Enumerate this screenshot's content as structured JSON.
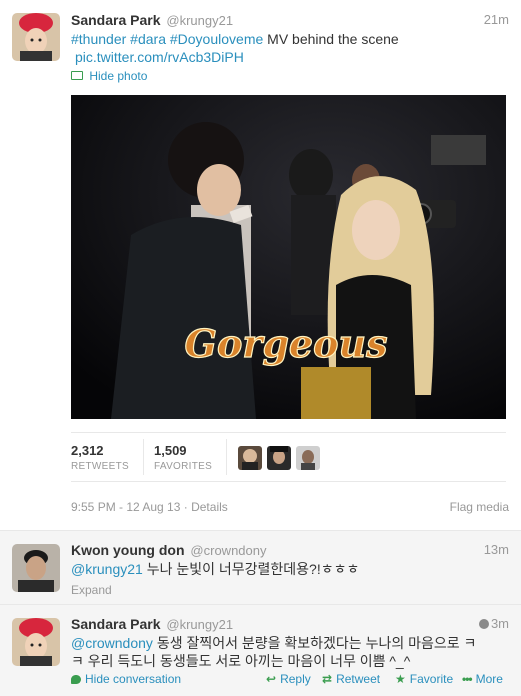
{
  "tweet1": {
    "name": "Sandara Park",
    "handle": "@krungy21",
    "time": "21m",
    "hashtags": [
      "#thunder",
      "#dara",
      "#Doyouloveme"
    ],
    "text_rest": "MV behind the scene",
    "pic_link": "pic.twitter.com/rvAcb3DiPH",
    "hide_photo": "Hide photo",
    "photo_caption": "Gorgeous",
    "retweets": "2,312",
    "retweets_label": "RETWEETS",
    "favorites": "1,509",
    "favorites_label": "FAVORITES",
    "timestamp": "9:55 PM - 12 Aug 13",
    "dot": "·",
    "details": "Details",
    "flag_media": "Flag media"
  },
  "tweet2": {
    "name": "Kwon young don",
    "handle": "@crowndony",
    "time": "13m",
    "mention": "@krungy21",
    "text": "누나 눈빛이 너무강렬한데용?!ㅎㅎㅎ",
    "expand": "Expand"
  },
  "tweet3": {
    "name": "Sandara Park",
    "handle": "@krungy21",
    "time": "3m",
    "mention": "@crowndony",
    "text_line1": "동생 잘찍어서 분량을 확보하겠다는 누나의 마음으로 ㅋ",
    "text_line2": "ㅋ 우리 득도니 동생들도 서로 아끼는 마음이 너무 이쁨 ^_^",
    "hide_conversation": "Hide conversation",
    "reply": "Reply",
    "retweet": "Retweet",
    "favorite": "Favorite",
    "more": "More"
  },
  "colors": {
    "link": "#2a8fbd",
    "muted": "#999999",
    "text": "#333333"
  },
  "icons": [
    "photo-icon",
    "globe-icon",
    "reply-icon",
    "retweet-icon",
    "favorite-star-icon",
    "more-dots-icon",
    "conversation-icon"
  ]
}
